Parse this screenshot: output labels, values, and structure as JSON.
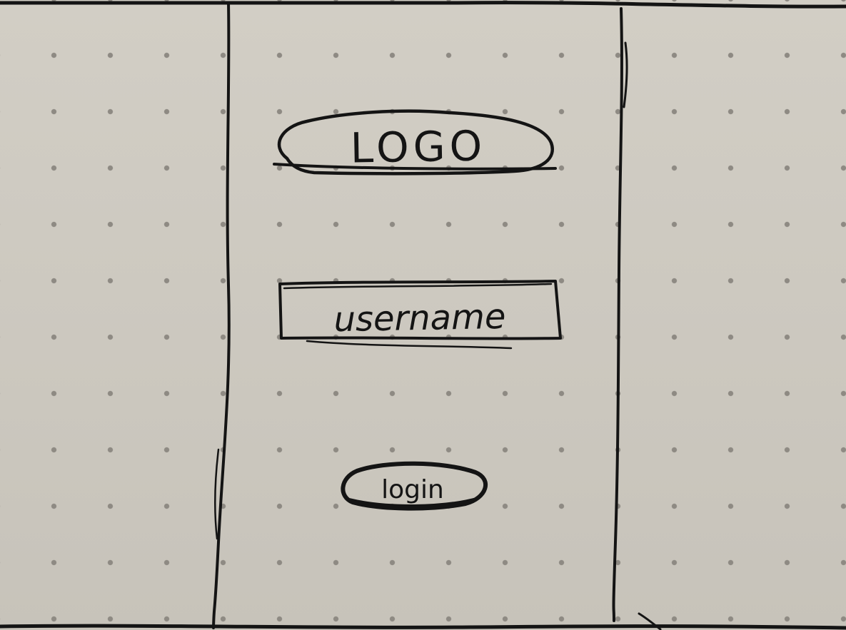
{
  "wireframe": {
    "logo": {
      "text": "LOGO"
    },
    "username_field": {
      "text": "username"
    },
    "login_button": {
      "text": "login"
    }
  }
}
